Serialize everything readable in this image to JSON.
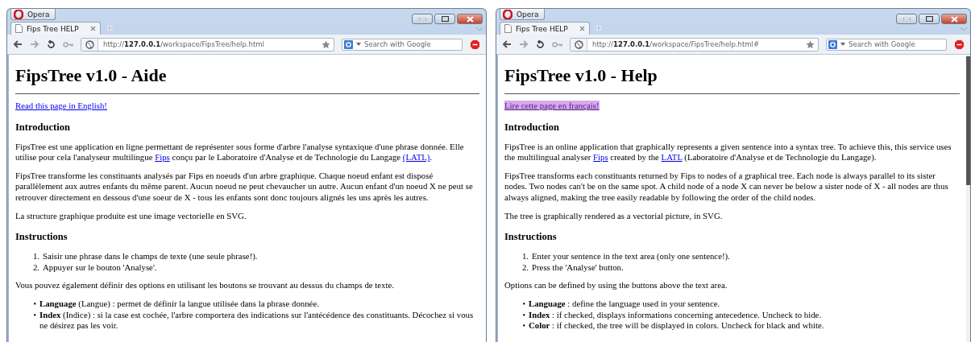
{
  "windows": [
    {
      "app_button": "Opera",
      "tab": {
        "title": "Fips Tree HELP",
        "selected": true
      },
      "address": "http://**127.0.0.1**/workspace/FipsTree/help.html",
      "search": {
        "placeholder": "Search with Google"
      },
      "scrollbar": false,
      "page": {
        "title": "FipsTree v1.0 - Aide",
        "switch_link": {
          "text": "Read this page in English!",
          "visited": false,
          "focused": false
        },
        "sections": [
          {
            "heading": "Introduction",
            "blocks": [
              {
                "kind": "paragraph",
                "parts": [
                  {
                    "text": "FipsTree est une application en ligne permettant de représenter sous forme d'arbre l'analyse syntaxique d'une phrase donnée. Elle utilise pour cela l'analyseur multilingue ",
                    "link": false
                  },
                  {
                    "text": "Fips",
                    "link": true
                  },
                  {
                    "text": " conçu par le Laboratoire d'Analyse et de Technologie du Langage ",
                    "link": false
                  },
                  {
                    "text": "(LATL)",
                    "link": true
                  },
                  {
                    "text": ".",
                    "link": false
                  }
                ]
              },
              {
                "kind": "paragraph",
                "parts": [
                  {
                    "text": "FipsTree transforme les constituants analysés par Fips en noeuds d'un arbre graphique. Chaque noeud enfant est disposé parallèlement aux autres enfants du même parent. Aucun noeud ne peut chevaucher un autre. Aucun enfant d'un noeud X ne peut se retrouver directement en dessous d'une soeur de X - tous les enfants sont donc toujours alignés les uns après les autres.",
                    "link": false
                  }
                ]
              },
              {
                "kind": "paragraph",
                "parts": [
                  {
                    "text": "La structure graphique produite est une image vectorielle en SVG.",
                    "link": false
                  }
                ]
              }
            ]
          },
          {
            "heading": "Instructions",
            "blocks": [
              {
                "kind": "ordered",
                "items": [
                  {
                    "marker": "1.",
                    "text": "Saisir une phrase dans le champs de texte (une seule phrase!)."
                  },
                  {
                    "marker": "2.",
                    "text": "Appuyer sur le bouton 'Analyse'."
                  }
                ]
              },
              {
                "kind": "paragraph",
                "parts": [
                  {
                    "text": "Vous pouvez également définir des options en utilisant les boutons se trouvant au dessus du champs de texte.",
                    "link": false
                  }
                ]
              },
              {
                "kind": "bulleted",
                "items": [
                  {
                    "marker": "•",
                    "text": "**Language** (Langue) : permet de définir la langue utilisée dans la phrase donnée."
                  },
                  {
                    "marker": "•",
                    "text": "**Index** (Indice) : si la case est cochée, l'arbre comportera des indications sur l'antécédence des constituants. Décochez si vous ne désirez pas les voir."
                  }
                ]
              }
            ]
          }
        ]
      }
    },
    {
      "app_button": "Opera",
      "tab": {
        "title": "Fips Tree HELP",
        "selected": true
      },
      "address": "http://**127.0.0.1**/workspace/FipsTree/help.html#",
      "search": {
        "placeholder": "Search with Google"
      },
      "scrollbar": true,
      "page": {
        "title": "FipsTree v1.0 - Help",
        "switch_link": {
          "text": "Lire cette page en français!",
          "visited": true,
          "focused": true
        },
        "sections": [
          {
            "heading": "Introduction",
            "blocks": [
              {
                "kind": "paragraph",
                "parts": [
                  {
                    "text": "FipsTree is an online application that graphically represents a given sentence into a syntax tree. To achieve this, this service uses the multilingual analyser ",
                    "link": false
                  },
                  {
                    "text": "Fips",
                    "link": true
                  },
                  {
                    "text": " created by the ",
                    "link": false
                  },
                  {
                    "text": "LATL",
                    "link": true
                  },
                  {
                    "text": " (Laboratoire d'Analyse et de Technologie du Langage).",
                    "link": false
                  }
                ]
              },
              {
                "kind": "paragraph",
                "parts": [
                  {
                    "text": "FipsTree transforms each constituants returned by Fips to nodes of a graphical tree. Each node is always parallel to its sister nodes. Two nodes can't be on the same spot. A child node of a node X can never be below a sister node of X - all nodes are thus always aligned, making the tree easily readable by following the order of the child nodes.",
                    "link": false
                  }
                ]
              },
              {
                "kind": "paragraph",
                "parts": [
                  {
                    "text": "The tree is graphically rendered as a vectorial picture, in SVG.",
                    "link": false
                  }
                ]
              }
            ]
          },
          {
            "heading": "Instructions",
            "blocks": [
              {
                "kind": "ordered",
                "items": [
                  {
                    "marker": "1.",
                    "text": "Enter your sentence in the text area (only one sentence!)."
                  },
                  {
                    "marker": "2.",
                    "text": "Press the 'Analyse' button."
                  }
                ]
              },
              {
                "kind": "paragraph",
                "parts": [
                  {
                    "text": "Options can be defined by using the buttons above the text area.",
                    "link": false
                  }
                ]
              },
              {
                "kind": "bulleted",
                "items": [
                  {
                    "marker": "•",
                    "text": "**Language** : define the language used in your sentence."
                  },
                  {
                    "marker": "•",
                    "text": "**Index** : if checked, displays informations concerning antecedence. Uncheck to hide."
                  },
                  {
                    "marker": "•",
                    "text": "**Color** : if checked, the tree will be displayed in colors. Uncheck for black and white."
                  }
                ]
              }
            ]
          }
        ]
      }
    }
  ]
}
